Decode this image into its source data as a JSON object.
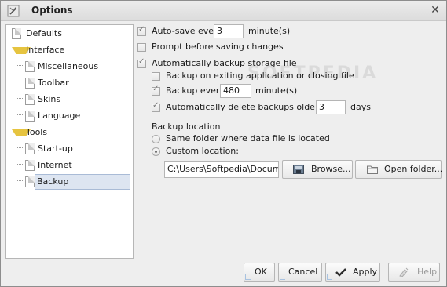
{
  "window": {
    "title": "Options"
  },
  "tree": [
    {
      "label": "Defaults",
      "type": "doc",
      "level": 0
    },
    {
      "label": "Interface",
      "type": "folder",
      "level": 0
    },
    {
      "label": "Miscellaneous",
      "type": "doc",
      "level": 1
    },
    {
      "label": "Toolbar",
      "type": "doc",
      "level": 1
    },
    {
      "label": "Skins",
      "type": "doc",
      "level": 1
    },
    {
      "label": "Language",
      "type": "doc",
      "level": 1
    },
    {
      "label": "Tools",
      "type": "folder",
      "level": 0
    },
    {
      "label": "Start-up",
      "type": "doc",
      "level": 1
    },
    {
      "label": "Internet",
      "type": "doc",
      "level": 1
    },
    {
      "label": "Backup",
      "type": "doc",
      "level": 1,
      "selected": true
    }
  ],
  "settings": {
    "autosave": {
      "checked": true,
      "label": "Auto-save every",
      "value": "3",
      "unit": "minute(s)"
    },
    "prompt": {
      "checked": false,
      "label": "Prompt before saving changes"
    },
    "auto_backup": {
      "checked": true,
      "label": "Automatically backup storage file"
    },
    "backup_on_exit": {
      "checked": false,
      "label": "Backup on exiting application or closing file"
    },
    "backup_every": {
      "checked": true,
      "label": "Backup every",
      "value": "480",
      "unit": "minute(s)"
    },
    "auto_delete": {
      "checked": true,
      "label": "Automatically delete backups older then",
      "value": "3",
      "unit": "days"
    },
    "location_heading": "Backup location",
    "radio_same": {
      "checked": false,
      "label": "Same folder where data file is located"
    },
    "radio_custom": {
      "checked": true,
      "label": "Custom location:"
    },
    "custom_path": "C:\\Users\\Softpedia\\Documen",
    "browse_label": "Browse...",
    "open_folder_label": "Open folder..."
  },
  "buttons": {
    "ok": "OK",
    "cancel": "Cancel",
    "apply": "Apply",
    "help": "Help"
  },
  "watermark": "SOFTPEDIA"
}
